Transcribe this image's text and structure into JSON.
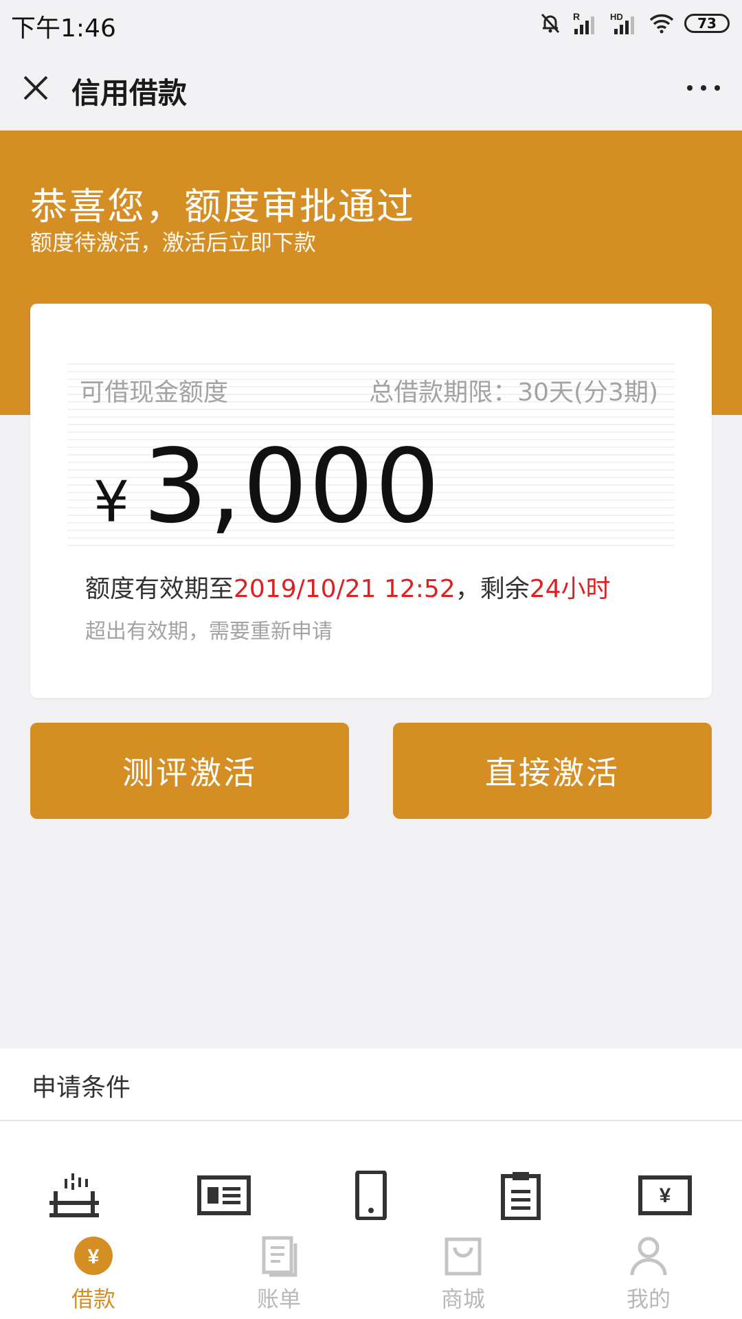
{
  "status_bar": {
    "time": "下午1:46",
    "battery": "73",
    "icons": [
      "mute-icon",
      "signal-r-icon",
      "signal-hd-icon",
      "wifi-icon",
      "battery-icon"
    ]
  },
  "nav": {
    "title": "信用借款",
    "close_icon": "close-icon",
    "more_icon": "more-icon"
  },
  "hero": {
    "title": "恭喜您，额度审批通过",
    "subtitle": "额度待激活，激活后立即下款"
  },
  "card": {
    "credit_label": "可借现金额度",
    "term_label": "总借款期限：30天(分3期)",
    "currency": "¥",
    "amount": "3,000",
    "validity_prefix": "额度有效期至",
    "validity_date": "2019/10/21 12:52",
    "validity_mid": "，剩余",
    "validity_remaining": "24小时",
    "note": "超出有效期，需要重新申请"
  },
  "buttons": {
    "evaluate_activate": "测评激活",
    "direct_activate": "直接激活"
  },
  "conditions": {
    "label": "申请条件",
    "icons": [
      "building-icon",
      "id-card-icon",
      "phone-icon",
      "clipboard-icon",
      "bank-card-icon"
    ]
  },
  "tabs": [
    {
      "label": "借款",
      "icon": "loan-icon",
      "active": true
    },
    {
      "label": "账单",
      "icon": "bill-icon",
      "active": false
    },
    {
      "label": "商城",
      "icon": "shop-icon",
      "active": false
    },
    {
      "label": "我的",
      "icon": "profile-icon",
      "active": false
    }
  ],
  "colors": {
    "accent": "#d48e24",
    "highlight_red": "#e02020",
    "background": "#f2f2f4"
  }
}
